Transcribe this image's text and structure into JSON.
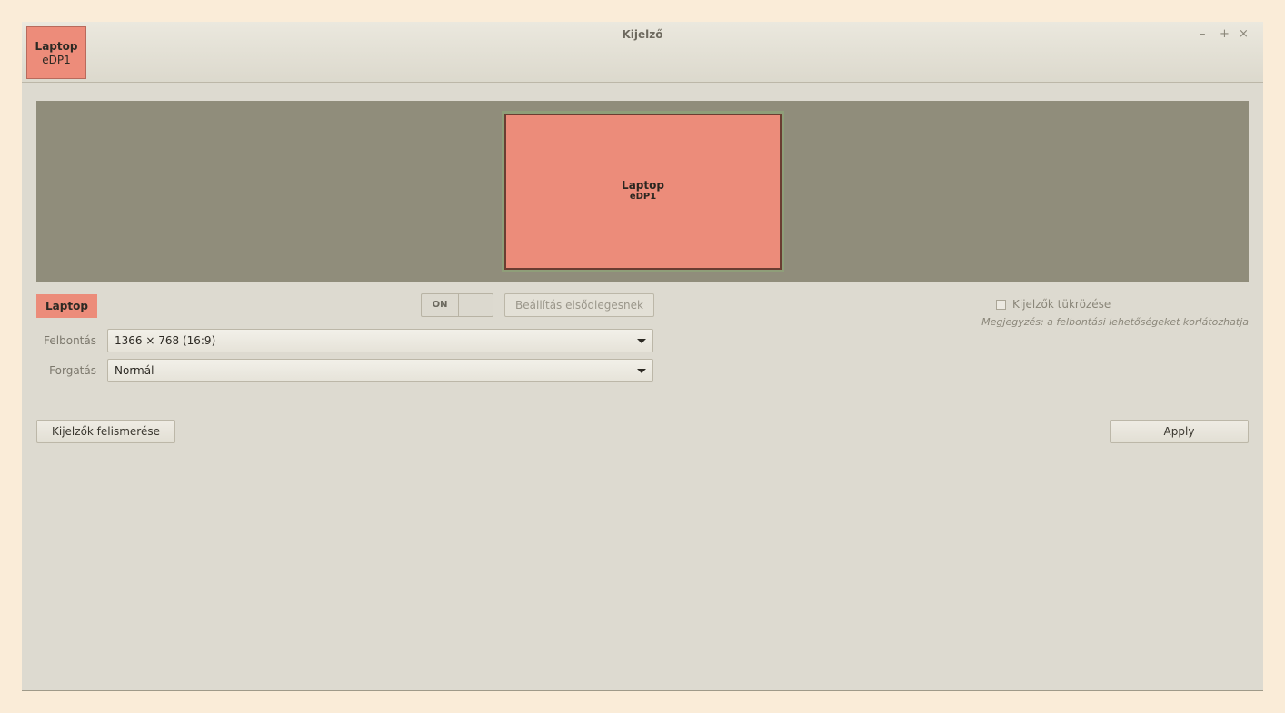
{
  "window": {
    "title": "Kijelző",
    "controls": {
      "minimize": "–",
      "maximize": "+",
      "close": "×"
    },
    "badge": {
      "name": "Laptop",
      "connector": "eDP1"
    }
  },
  "canvas": {
    "monitor": {
      "name": "Laptop",
      "connector": "eDP1"
    }
  },
  "output": {
    "name": "Laptop",
    "toggle_label": "ON",
    "primary_button": "Beállítás elsődlegesnek",
    "resolution_label": "Felbontás",
    "resolution_value": "1366 × 768 (16:9)",
    "rotation_label": "Forgatás",
    "rotation_value": "Normál"
  },
  "mirror": {
    "label": "Kijelzők tükrözése",
    "checked": false,
    "note": "Megjegyzés: a felbontási lehetőségeket korlátozhatja"
  },
  "buttons": {
    "detect": "Kijelzők felismerése",
    "apply": "Apply"
  },
  "colors": {
    "monitor": "#ec8c7a",
    "canvas": "#908d7b",
    "window": "#dddad0"
  }
}
